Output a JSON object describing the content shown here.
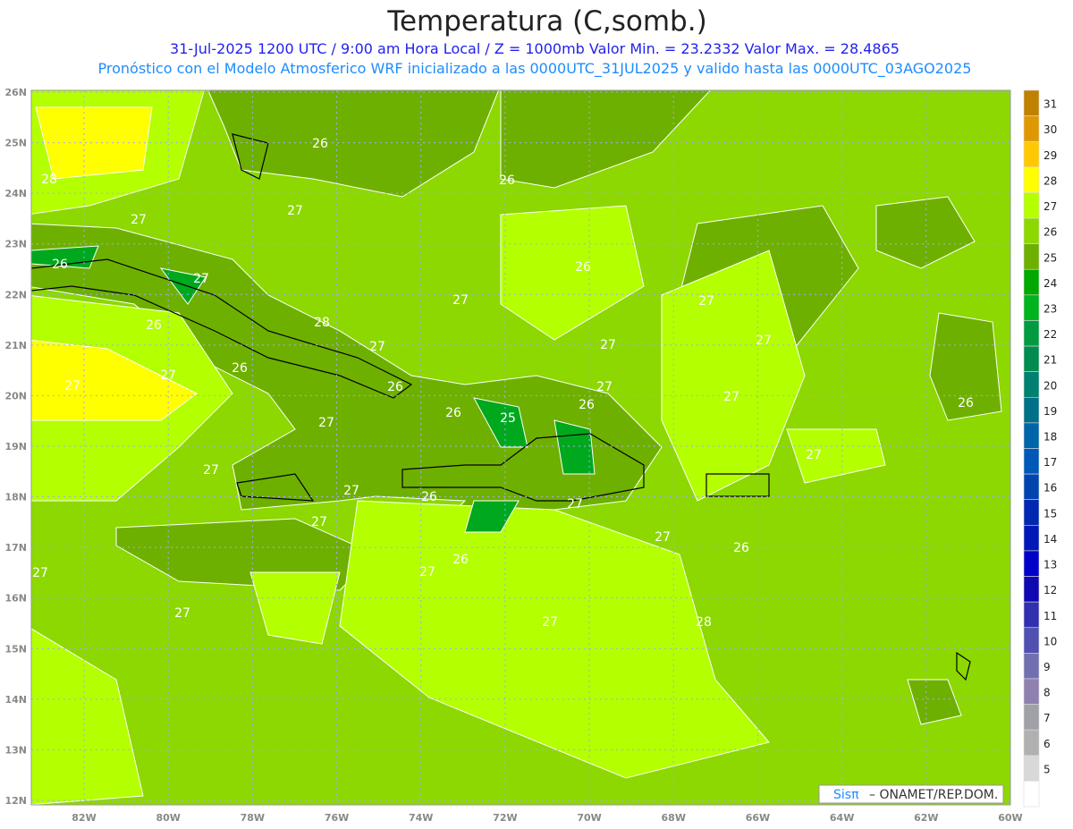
{
  "header": {
    "title": "Temperatura (C,somb.)",
    "line1": "31-Jul-2025  1200 UTC / 9:00 am Hora Local / Z = 1000mb   Valor Min. = 23.2332  Valor Max. = 28.4865",
    "line2": "Pronóstico con el Modelo Atmosferico WRF inicializado a las 0000UTC_31JUL2025 y valido hasta las  0000UTC_03AGO2025"
  },
  "axes": {
    "lon_labels": [
      "82W",
      "80W",
      "78W",
      "76W",
      "74W",
      "72W",
      "70W",
      "68W",
      "66W",
      "64W",
      "62W",
      "60W"
    ],
    "lat_labels": [
      "26N",
      "25N",
      "24N",
      "23N",
      "22N",
      "21N",
      "20N",
      "19N",
      "18N",
      "17N",
      "16N",
      "15N",
      "14N",
      "13N",
      "12N"
    ]
  },
  "colorbar": {
    "labels": [
      "31",
      "30",
      "29",
      "28",
      "27",
      "26",
      "25",
      "24",
      "23",
      "22",
      "21",
      "20",
      "19",
      "18",
      "17",
      "16",
      "15",
      "14",
      "13",
      "12",
      "11",
      "10",
      "9",
      "8",
      "7",
      "6",
      "5"
    ],
    "colors": [
      "#c08000",
      "#e09800",
      "#ffc800",
      "#ffff00",
      "#b4ff00",
      "#8cd800",
      "#6eb000",
      "#00a800",
      "#00b41e",
      "#009a40",
      "#008c50",
      "#008070",
      "#007088",
      "#0064a8",
      "#0058b8",
      "#0044b0",
      "#0028b0",
      "#0018b8",
      "#0000c8",
      "#1008b0",
      "#3030b0",
      "#5050b0",
      "#7070b0",
      "#9080b0",
      "#a0a0a8",
      "#b0b0b0",
      "#d8d8d8",
      "#ffffff"
    ]
  },
  "contour_labels": [
    "26",
    "28",
    "27",
    "26",
    "27",
    "26",
    "27",
    "27",
    "28",
    "26",
    "26",
    "27",
    "27",
    "27",
    "25",
    "26",
    "27",
    "27",
    "26",
    "27",
    "27",
    "26",
    "27",
    "26",
    "27",
    "27",
    "27",
    "27",
    "27",
    "27",
    "27",
    "26",
    "27",
    "27",
    "27",
    "26",
    "27",
    "28",
    "26",
    "26"
  ],
  "colors": {
    "base": "#8cd800"
  },
  "credit": {
    "brand": "Sisπ",
    "text": "– ONAMET/REP.DOM."
  }
}
